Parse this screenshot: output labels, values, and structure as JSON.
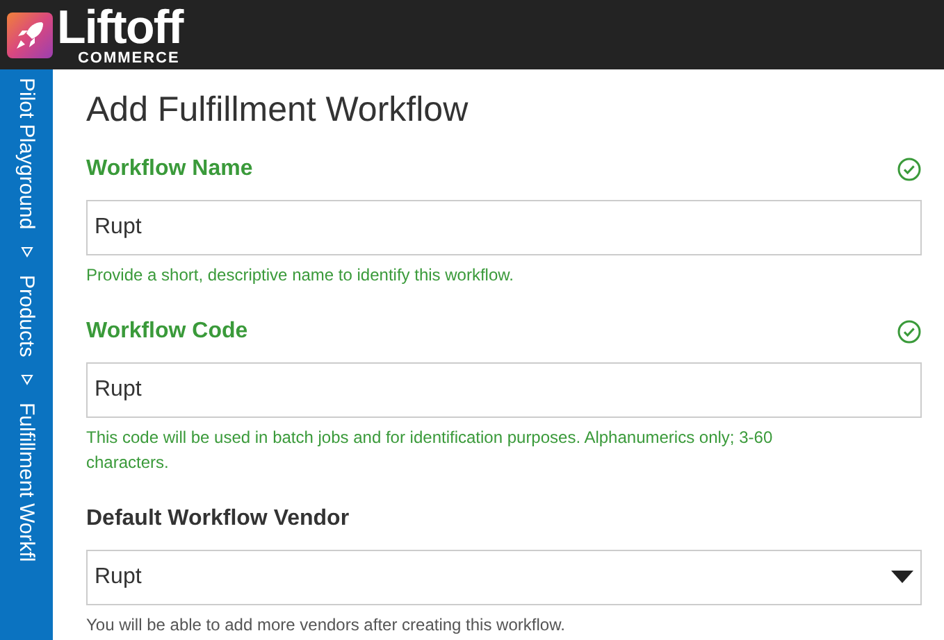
{
  "header": {
    "logo_word": "Liftoff",
    "logo_sub": "COMMERCE"
  },
  "breadcrumb": [
    "Pilot Playground",
    "Products",
    "Fulfillment Workfl"
  ],
  "page_title": "Add Fulfillment Workflow",
  "fields": [
    {
      "kind": "text",
      "label": "Workflow Name",
      "valid": true,
      "value": "Rupt",
      "help": "Provide a short, descriptive name to identify this workflow."
    },
    {
      "kind": "text",
      "label": "Workflow Code",
      "valid": true,
      "value": "Rupt",
      "help": "This code will be used in batch jobs and for identification purposes. Alphanumerics only; 3-60 characters."
    },
    {
      "kind": "select",
      "label": "Default Workflow Vendor",
      "valid": false,
      "value": "Rupt",
      "help": "You will be able to add more vendors after creating this workflow."
    }
  ]
}
